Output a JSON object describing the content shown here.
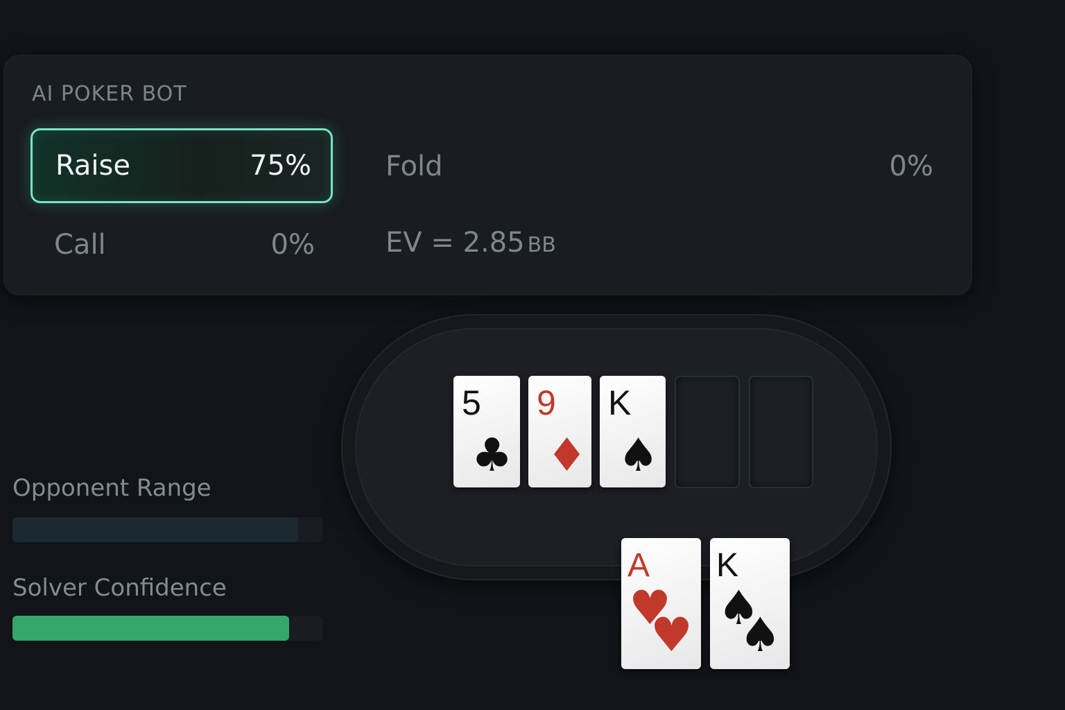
{
  "panel": {
    "title": "AI POKER BOT",
    "actions": {
      "raise": {
        "label": "Raise",
        "value": "75%"
      },
      "fold": {
        "label": "Fold",
        "value": "0%"
      },
      "call": {
        "label": "Call",
        "value": "0%"
      }
    },
    "ev": {
      "text": "EV = 2.85",
      "unit": "BB"
    }
  },
  "board": {
    "cards": [
      {
        "rank": "5",
        "suit": "♣",
        "color": "#111111"
      },
      {
        "rank": "9",
        "suit": "♦",
        "color": "#c0392b"
      },
      {
        "rank": "K",
        "suit": "♠",
        "color": "#111111"
      }
    ],
    "empty_slots": 2
  },
  "hole": {
    "cards": [
      {
        "rank": "A",
        "suit": "♥",
        "color": "#c0392b"
      },
      {
        "rank": "K",
        "suit": "♠",
        "color": "#111111"
      }
    ]
  },
  "meters": {
    "opponent_range": {
      "label": "Opponent Range",
      "fill_fraction": 0.92,
      "color": "#1b2a31"
    },
    "solver_confidence": {
      "label": "Solver Confidence",
      "fill_fraction": 0.89,
      "color": "#35a76a"
    }
  }
}
